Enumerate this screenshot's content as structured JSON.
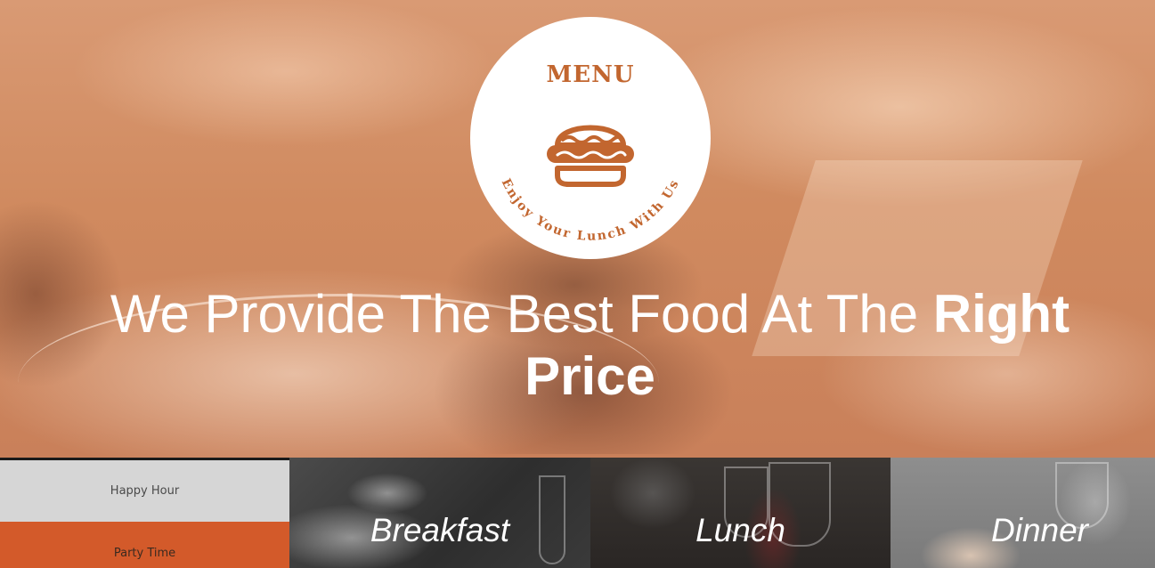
{
  "badge": {
    "title": "MENU",
    "tagline": "Enjoy Your Lunch With Us",
    "icon": "burger-icon"
  },
  "hero": {
    "headline_regular": "We Provide The Best Food At The ",
    "headline_bold": "Right Price"
  },
  "side_menu": {
    "items": [
      {
        "label": "Happy Hour"
      },
      {
        "label": "Party Time"
      }
    ]
  },
  "tiles": [
    {
      "label": "Breakfast"
    },
    {
      "label": "Lunch"
    },
    {
      "label": "Dinner"
    }
  ],
  "colors": {
    "brand_orange": "#c2662f",
    "party_orange": "#d35a2a",
    "hero_overlay": "#d08a5f"
  }
}
